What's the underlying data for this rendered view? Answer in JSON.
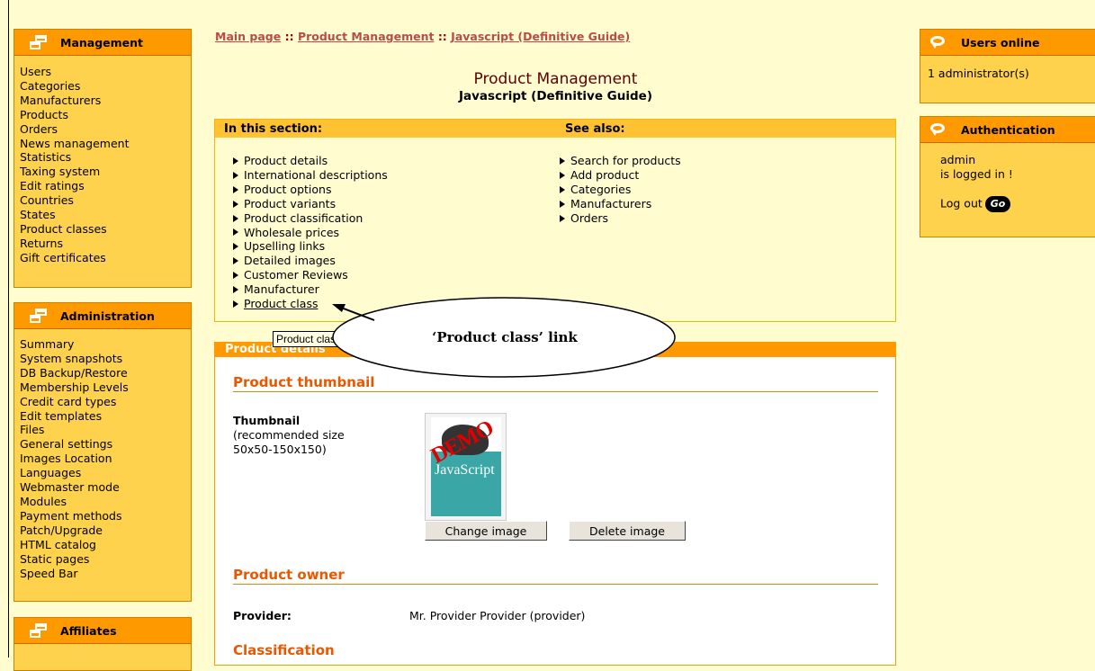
{
  "management": {
    "title": "Management",
    "items": [
      "Users",
      "Categories",
      "Manufacturers",
      "Products",
      "Orders",
      "News management",
      "Statistics",
      "Taxing system",
      "Edit ratings",
      "Countries",
      "States",
      "Product classes",
      "Returns",
      "Gift certificates"
    ]
  },
  "administration": {
    "title": "Administration",
    "items": [
      "Summary",
      "System snapshots",
      "DB Backup/Restore",
      "Membership Levels",
      "Credit card types",
      "Edit templates",
      "Files",
      "General settings",
      "Images Location",
      "Languages",
      "Webmaster mode",
      "Modules",
      "Payment methods",
      "Patch/Upgrade",
      "HTML catalog",
      "Static pages",
      "Speed Bar"
    ]
  },
  "affiliates": {
    "title": "Affiliates"
  },
  "breadcrumb": {
    "home": "Main page",
    "section": "Product Management",
    "current": "Javascript (Definitive Guide)",
    "separator": "::"
  },
  "page": {
    "title": "Product Management",
    "subtitle": "Javascript (Definitive Guide)"
  },
  "in_section": {
    "title": "In this section:",
    "links": [
      "Product details",
      "International descriptions",
      "Product options",
      "Product variants",
      "Product classification",
      "Wholesale prices",
      "Upselling links",
      "Detailed images",
      "Customer Reviews",
      "Manufacturer",
      "Product class"
    ]
  },
  "see_also": {
    "title": "See also:",
    "links": [
      "Search for products",
      "Add product",
      "Categories",
      "Manufacturers",
      "Orders"
    ]
  },
  "tooltip": "Product class",
  "callout": "‘Product class’ link",
  "details": {
    "header": "Product details",
    "thumbnail_heading": "Product thumbnail",
    "thumbnail_label": "Thumbnail",
    "thumbnail_note_1": "(recommended size",
    "thumbnail_note_2": "50x50-150x150)",
    "change_image": "Change image",
    "delete_image": "Delete image",
    "owner_heading": "Product owner",
    "provider_label": "Provider:",
    "provider_value": "Mr. Provider Provider (provider)",
    "classification_heading": "Classification"
  },
  "thumb_image": {
    "demo_stamp": "DEMO",
    "cover_title": "JavaScript"
  },
  "users_online": {
    "title": "Users online",
    "count_text": "1 administrator(s)"
  },
  "authentication": {
    "title": "Authentication",
    "user": "admin",
    "status": "is logged in !",
    "logout_label": "Log out",
    "go_label": "Go"
  }
}
